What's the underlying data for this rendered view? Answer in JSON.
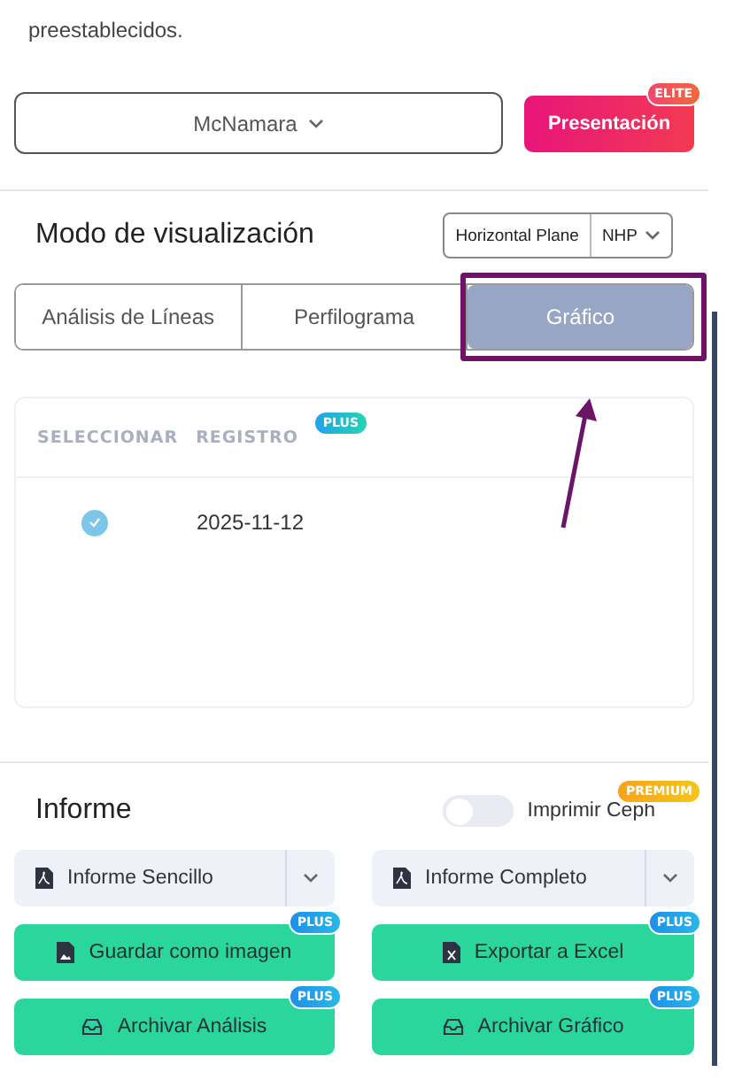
{
  "intro_text": "preestablecidos.",
  "analysis_select": {
    "value": "McNamara"
  },
  "presentation_button": {
    "label": "Presentación",
    "badge": "ELITE"
  },
  "view_mode": {
    "title": "Modo de visualización",
    "plane_label": "Horizontal Plane",
    "plane_value": "NHP"
  },
  "tabs": [
    {
      "label": "Análisis de Líneas",
      "selected": false
    },
    {
      "label": "Perfilograma",
      "selected": false
    },
    {
      "label": "Gráfico",
      "selected": true,
      "highlighted": true
    }
  ],
  "table": {
    "columns": [
      "SELECCIONAR",
      "REGISTRO"
    ],
    "column_badge": "PLUS",
    "rows": [
      {
        "checked": true,
        "date": "2025-11-12"
      }
    ]
  },
  "report": {
    "title": "Informe",
    "print_ceph": {
      "label": "Imprimir Ceph",
      "on": false,
      "badge": "PREMIUM"
    },
    "buttons": [
      {
        "kind": "split",
        "label": "Informe Sencillo"
      },
      {
        "kind": "split",
        "label": "Informe Completo"
      },
      {
        "kind": "action",
        "label": "Guardar como imagen",
        "badge": "PLUS"
      },
      {
        "kind": "action",
        "label": "Exportar a Excel",
        "badge": "PLUS"
      },
      {
        "kind": "action",
        "label": "Archivar Análisis",
        "badge": "PLUS"
      },
      {
        "kind": "action",
        "label": "Archivar Gráfico",
        "badge": "PLUS"
      }
    ]
  }
}
